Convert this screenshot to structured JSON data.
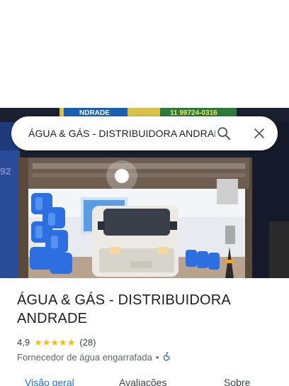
{
  "search": {
    "query": "ÁGUA & GÁS - DISTRIBUIDORA ANDRADE",
    "search_icon": "search-icon",
    "close_icon": "close-icon"
  },
  "photo": {
    "description_icon": "storefront-photo",
    "sign_text_left": "NDRADE",
    "sign_text_right": "11 99724-0316",
    "number_left": "92"
  },
  "place": {
    "title": "ÁGUA & GÁS - DISTRIBUIDORA ANDRADE",
    "rating": "4,9",
    "stars": 5,
    "review_count": "(28)",
    "category": "Fornecedor de água engarrafada",
    "separator": "•",
    "accessibility_icon": "wheelchair-accessible-icon"
  },
  "tabs": [
    {
      "label": "Visão geral",
      "active": true
    },
    {
      "label": "Avaliações",
      "active": false
    },
    {
      "label": "Sobre",
      "active": false
    }
  ],
  "colors": {
    "accent": "#1a73e8",
    "star": "#fbbc04",
    "text": "#202124",
    "secondary": "#5f6368"
  }
}
